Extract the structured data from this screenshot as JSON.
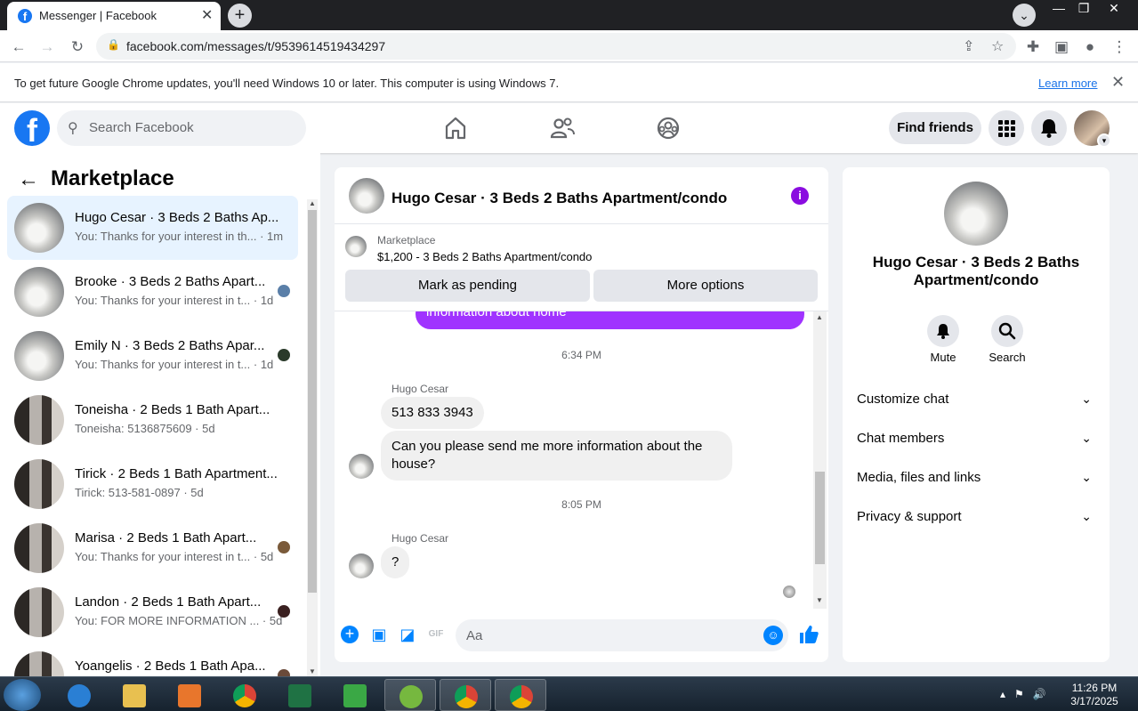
{
  "browser": {
    "tab_title": "Messenger | Facebook",
    "url": "facebook.com/messages/t/9539614519434297",
    "infobar_message": "To get future Google Chrome updates, you'll need Windows 10 or later. This computer is using Windows 7.",
    "infobar_link": "Learn more"
  },
  "fb_header": {
    "search_placeholder": "Search Facebook",
    "find_friends": "Find friends"
  },
  "left_panel": {
    "title": "Marketplace",
    "conversations": [
      {
        "name": "Hugo Cesar · 3 Beds 2 Baths Ap...",
        "preview": "You: Thanks for your interest in th... · 1m",
        "thumb": "light",
        "selected": true
      },
      {
        "name": "Brooke · 3 Beds 2 Baths Apart...",
        "preview": "You: Thanks for your interest in t... · 1d",
        "thumb": "light"
      },
      {
        "name": "Emily N · 3 Beds 2 Baths Apar...",
        "preview": "You: Thanks for your interest in t... · 1d",
        "thumb": "light"
      },
      {
        "name": "Toneisha · 2 Beds 1 Bath Apart...",
        "preview": "Toneisha: 5136875609 · 5d",
        "thumb": "dark"
      },
      {
        "name": "Tirick · 2 Beds 1 Bath Apartment...",
        "preview": "Tirick: 513-581-0897 · 5d",
        "thumb": "dark"
      },
      {
        "name": "Marisa · 2 Beds 1 Bath Apart...",
        "preview": "You: Thanks for your interest in t... · 5d",
        "thumb": "dark"
      },
      {
        "name": "Landon · 2 Beds 1 Bath Apart...",
        "preview": "You: FOR MORE INFORMATION ... · 5d",
        "thumb": "dark"
      },
      {
        "name": "Yoangelis · 2 Beds 1 Bath Apa...",
        "preview": "",
        "thumb": "dark"
      }
    ]
  },
  "chat": {
    "title": "Hugo Cesar · 3 Beds 2 Baths Apartment/condo",
    "marketplace_label": "Marketplace",
    "listing": "$1,200 - 3 Beds 2 Baths Apartment/condo",
    "mark_pending": "Mark as pending",
    "more_options": "More options",
    "sent_partial": "information about home",
    "time1": "6:34 PM",
    "sender1": "Hugo Cesar",
    "msg1": "513 833 3943",
    "msg2": "Can you please send me more information about the house?",
    "time2": "8:05 PM",
    "sender2": "Hugo Cesar",
    "msg3": "?",
    "composer_placeholder": "Aa"
  },
  "right_panel": {
    "name": "Hugo Cesar · 3 Beds 2 Baths Apartment/condo",
    "mute": "Mute",
    "search": "Search",
    "sections": [
      "Customize chat",
      "Chat members",
      "Media, files and links",
      "Privacy & support"
    ]
  },
  "taskbar": {
    "time": "11:26 PM",
    "date": "3/17/2025"
  },
  "colors": {
    "fb_blue": "#1877f2",
    "messenger_purple": "#a033ff",
    "selected_row": "#e7f3ff"
  }
}
